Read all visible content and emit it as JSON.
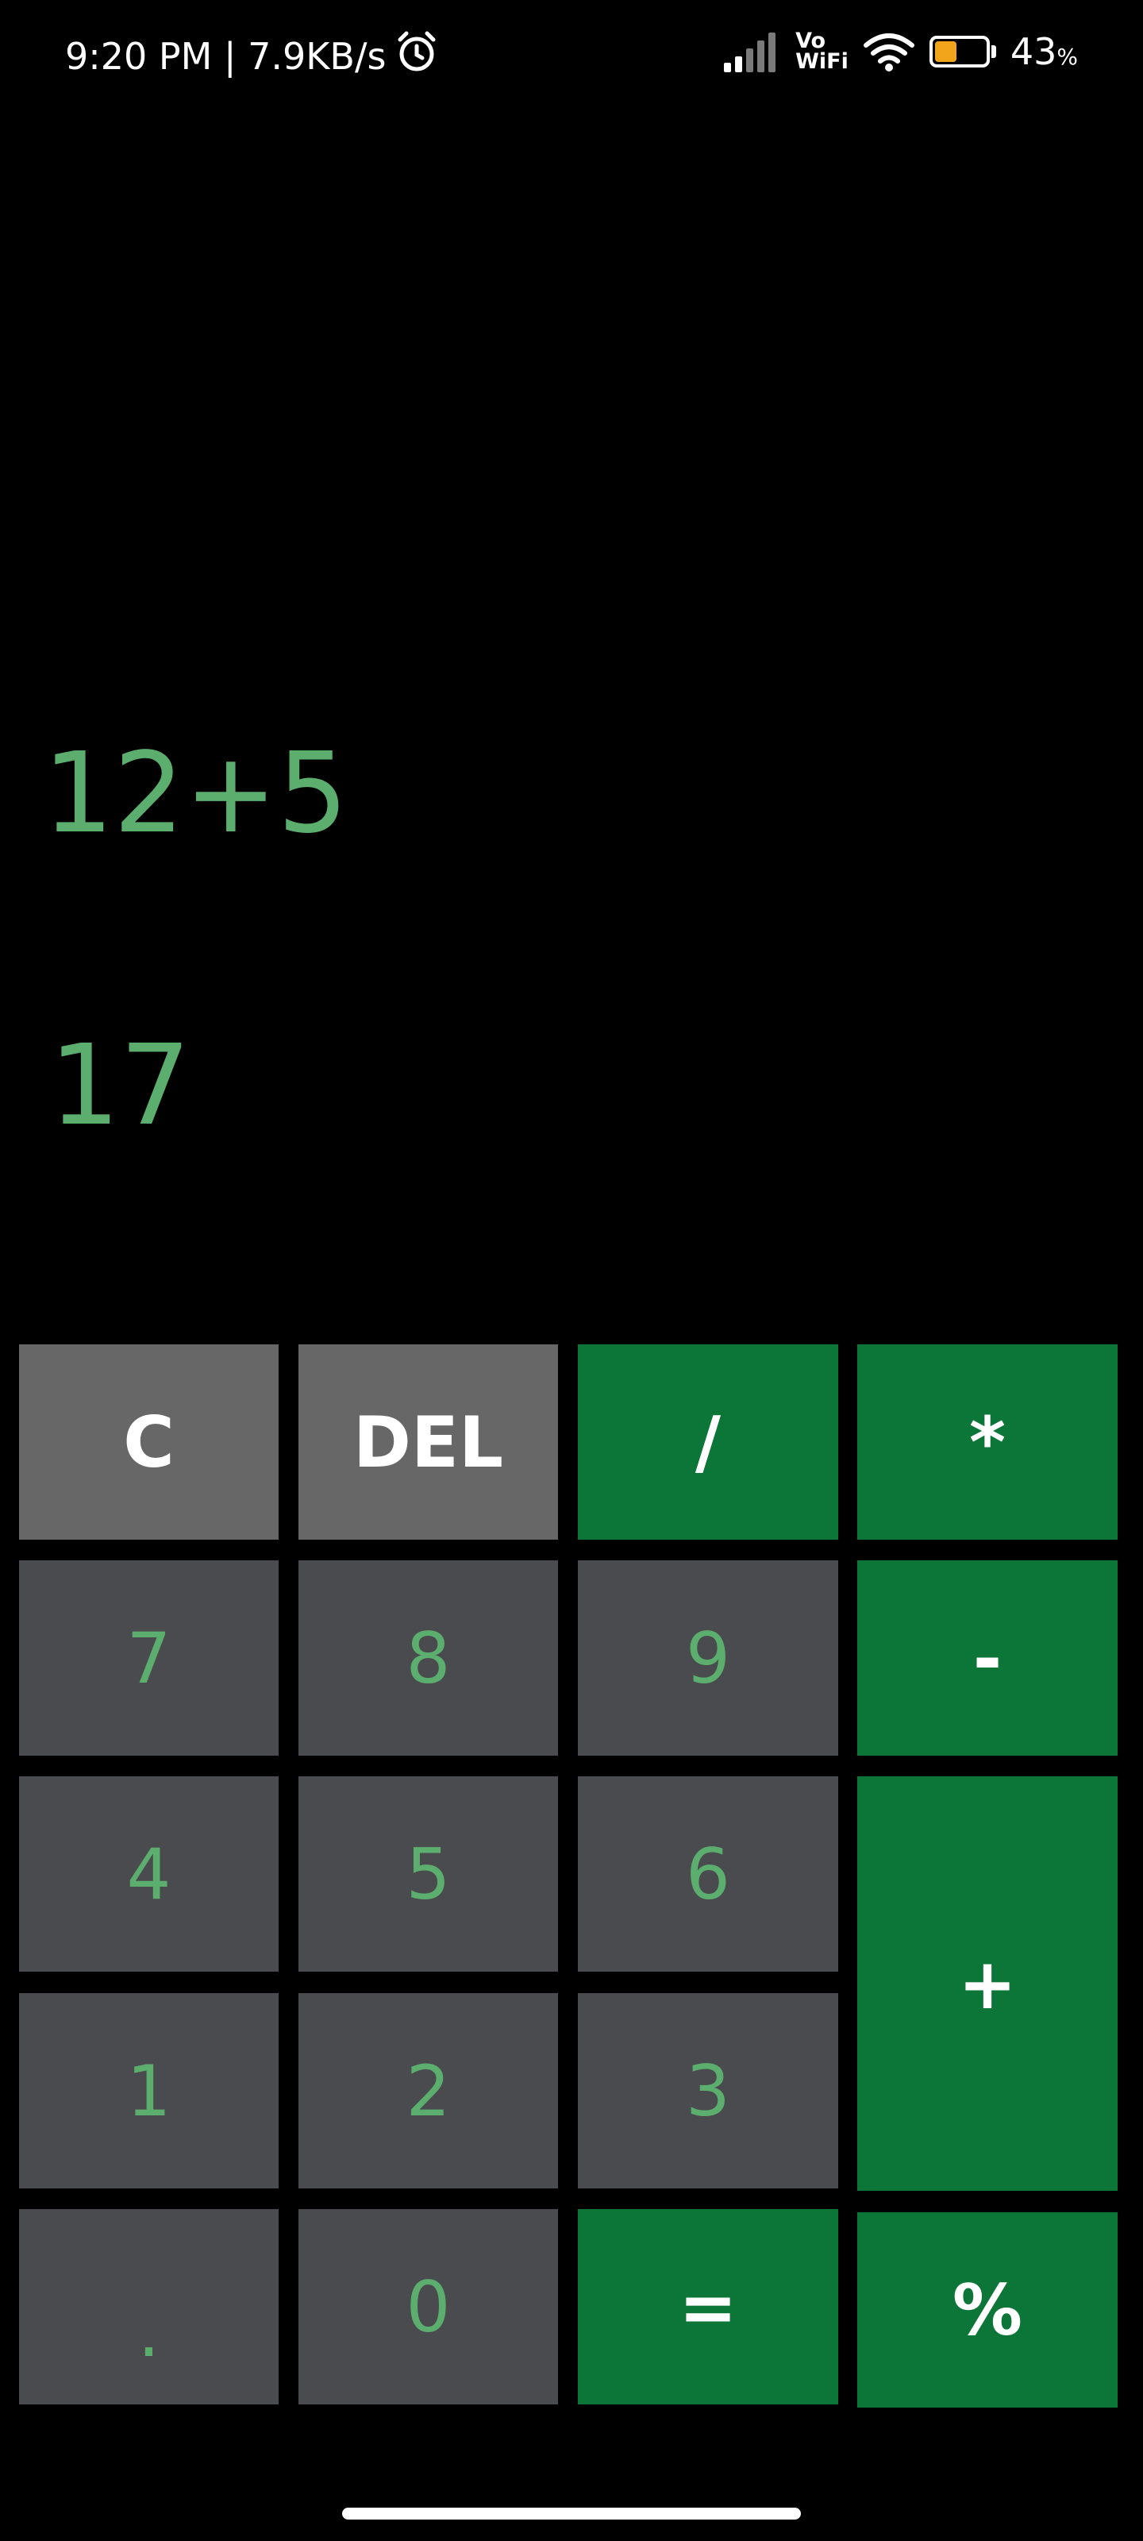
{
  "status_bar": {
    "time_speed": "9:20 PM | 7.9KB/s",
    "alarm_icon": "alarm-clock-icon",
    "vo_label": "Vo",
    "wifi_label": "WiFi",
    "battery_percent": "43",
    "battery_unit": "%",
    "battery_level": 0.43,
    "battery_fill_color": "#f2a51a"
  },
  "display": {
    "expression": "12+5",
    "result": "17",
    "text_color": "#5cae6e"
  },
  "keypad": {
    "clear": "C",
    "delete": "DEL",
    "divide": "/",
    "multiply": "*",
    "seven": "7",
    "eight": "8",
    "nine": "9",
    "minus": "-",
    "four": "4",
    "five": "5",
    "six": "6",
    "plus": "+",
    "one": "1",
    "two": "2",
    "three": "3",
    "dot": ".",
    "zero": "0",
    "equals": "=",
    "percent": "%"
  },
  "colors": {
    "background": "#000000",
    "function_key": "#666766",
    "operator_key": "#0c7538",
    "number_key": "#4a4b4f",
    "number_text": "#5cae6e"
  }
}
